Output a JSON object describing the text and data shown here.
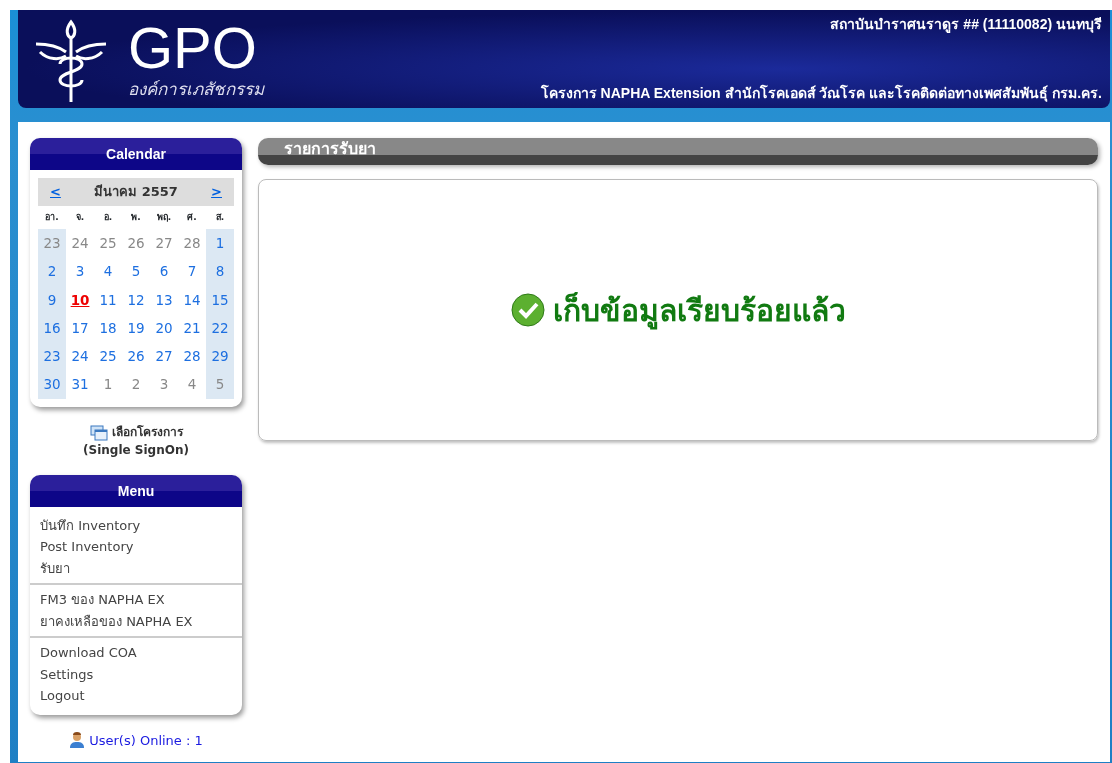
{
  "header": {
    "logo_text": "GPO",
    "logo_subtitle": "องค์การเภสัชกรรม",
    "facility": "สถาบันบำราศนราดูร ## (11110082) นนทบุรี",
    "project": "โครงการ NAPHA Extension สำนักโรคเอดส์ วัณโรค และโรคติดต่อทางเพศสัมพันธุ์ กรม.คร."
  },
  "calendar": {
    "title": "Calendar",
    "prev": "<",
    "month": "มีนาคม 2557",
    "next": ">",
    "weekdays": [
      "อา.",
      "จ.",
      "อ.",
      "พ.",
      "พฤ.",
      "ศ.",
      "ส."
    ],
    "weeks": [
      [
        {
          "d": "23",
          "other": true,
          "today": false
        },
        {
          "d": "24",
          "other": true,
          "today": false
        },
        {
          "d": "25",
          "other": true,
          "today": false
        },
        {
          "d": "26",
          "other": true,
          "today": false
        },
        {
          "d": "27",
          "other": true,
          "today": false
        },
        {
          "d": "28",
          "other": true,
          "today": false
        },
        {
          "d": "1",
          "other": false,
          "today": false
        }
      ],
      [
        {
          "d": "2",
          "other": false,
          "today": false
        },
        {
          "d": "3",
          "other": false,
          "today": false
        },
        {
          "d": "4",
          "other": false,
          "today": false
        },
        {
          "d": "5",
          "other": false,
          "today": false
        },
        {
          "d": "6",
          "other": false,
          "today": false
        },
        {
          "d": "7",
          "other": false,
          "today": false
        },
        {
          "d": "8",
          "other": false,
          "today": false
        }
      ],
      [
        {
          "d": "9",
          "other": false,
          "today": false
        },
        {
          "d": "10",
          "other": false,
          "today": true
        },
        {
          "d": "11",
          "other": false,
          "today": false
        },
        {
          "d": "12",
          "other": false,
          "today": false
        },
        {
          "d": "13",
          "other": false,
          "today": false
        },
        {
          "d": "14",
          "other": false,
          "today": false
        },
        {
          "d": "15",
          "other": false,
          "today": false
        }
      ],
      [
        {
          "d": "16",
          "other": false,
          "today": false
        },
        {
          "d": "17",
          "other": false,
          "today": false
        },
        {
          "d": "18",
          "other": false,
          "today": false
        },
        {
          "d": "19",
          "other": false,
          "today": false
        },
        {
          "d": "20",
          "other": false,
          "today": false
        },
        {
          "d": "21",
          "other": false,
          "today": false
        },
        {
          "d": "22",
          "other": false,
          "today": false
        }
      ],
      [
        {
          "d": "23",
          "other": false,
          "today": false
        },
        {
          "d": "24",
          "other": false,
          "today": false
        },
        {
          "d": "25",
          "other": false,
          "today": false
        },
        {
          "d": "26",
          "other": false,
          "today": false
        },
        {
          "d": "27",
          "other": false,
          "today": false
        },
        {
          "d": "28",
          "other": false,
          "today": false
        },
        {
          "d": "29",
          "other": false,
          "today": false
        }
      ],
      [
        {
          "d": "30",
          "other": false,
          "today": false
        },
        {
          "d": "31",
          "other": false,
          "today": false
        },
        {
          "d": "1",
          "other": true,
          "today": false
        },
        {
          "d": "2",
          "other": true,
          "today": false
        },
        {
          "d": "3",
          "other": true,
          "today": false
        },
        {
          "d": "4",
          "other": true,
          "today": false
        },
        {
          "d": "5",
          "other": true,
          "today": false
        }
      ]
    ]
  },
  "project_select": {
    "label": "เลือกโครงการ",
    "sublabel": "(Single SignOn)"
  },
  "menu": {
    "title": "Menu",
    "groups": [
      [
        "บันทึก Inventory",
        "Post Inventory",
        "รับยา"
      ],
      [
        "FM3 ของ NAPHA EX",
        "ยาคงเหลือของ NAPHA EX"
      ],
      [
        "Download COA",
        "Settings",
        "Logout"
      ]
    ]
  },
  "users_online": "User(s) Online : 1",
  "section_title": "รายการรับยา",
  "message": "เก็บข้อมูลเรียบร้อยแล้ว"
}
